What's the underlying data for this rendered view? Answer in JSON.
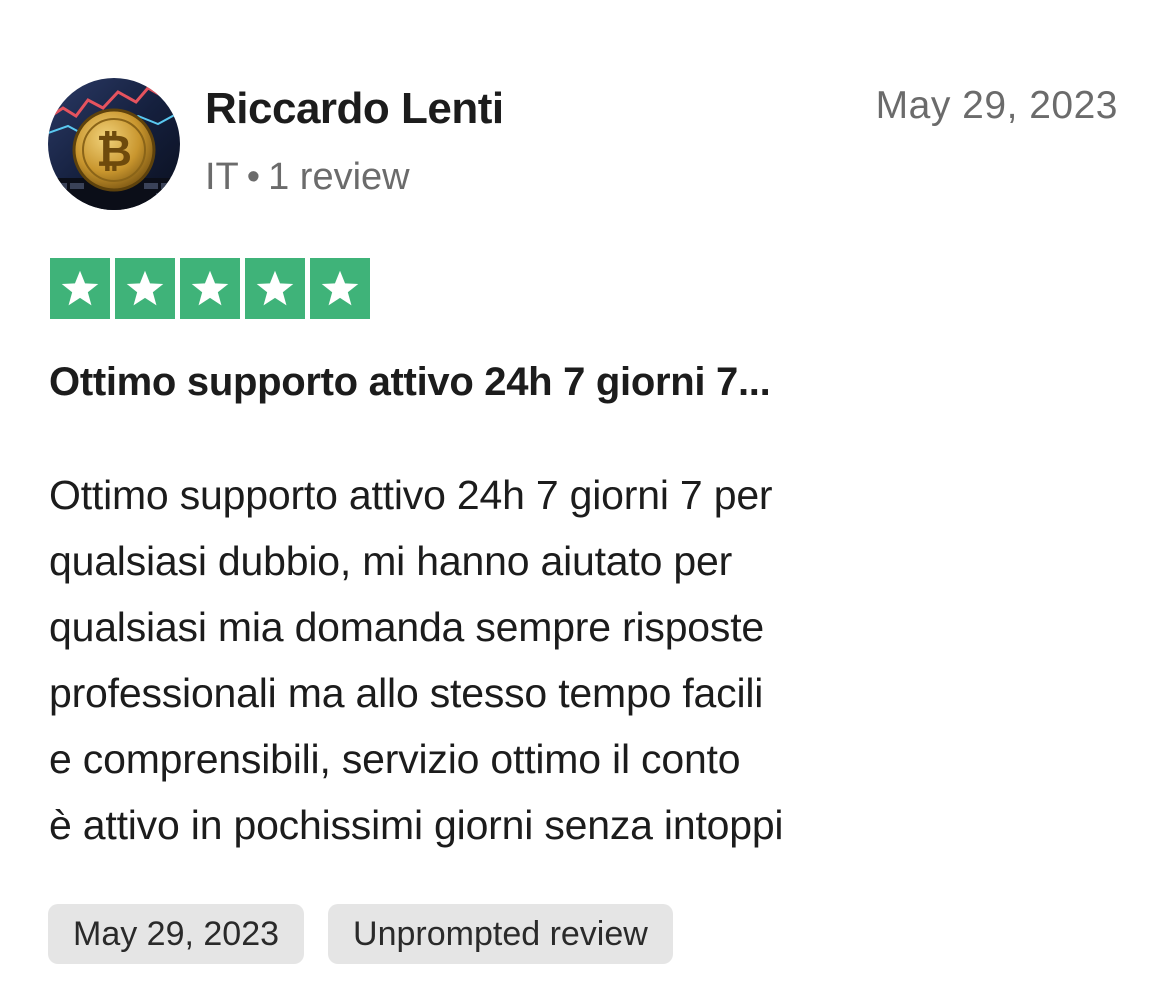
{
  "reviewer": {
    "name": "Riccardo Lenti",
    "country": "IT",
    "separator": "•",
    "review_count": "1 review",
    "avatar_icon": "bitcoin-avatar-icon"
  },
  "review": {
    "date": "May 29, 2023",
    "rating": 5,
    "rating_max": 5,
    "title": "Ottimo supporto attivo 24h 7 giorni 7...",
    "body_lines": [
      "Ottimo supporto attivo 24h 7 giorni 7 per",
      "qualsiasi dubbio, mi hanno aiutato per",
      "qualsiasi mia domanda sempre risposte",
      "professionali ma allo stesso tempo facili",
      "e comprensibili, servizio ottimo il conto",
      "è attivo in pochissimi giorni senza intoppi"
    ]
  },
  "tags": {
    "experience_date": "May 29, 2023",
    "review_type": "Unprompted review"
  },
  "colors": {
    "star_background": "#3fb379",
    "chip_background": "#e5e5e5",
    "muted_text": "#6b6b6b"
  }
}
